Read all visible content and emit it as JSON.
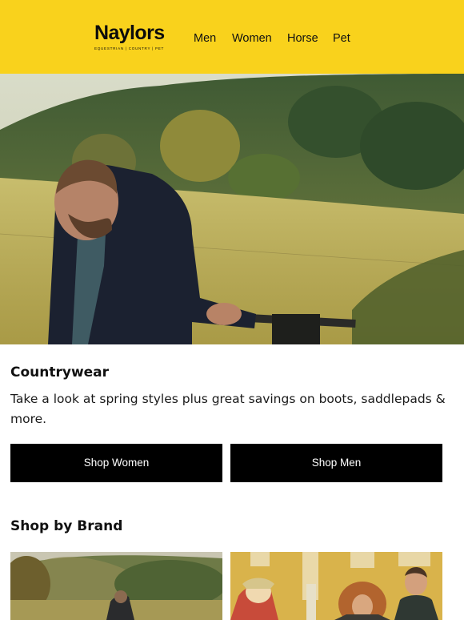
{
  "header": {
    "logo": "Naylors",
    "tagline": "EQUESTRIAN | COUNTRY | PET",
    "nav": [
      "Men",
      "Women",
      "Horse",
      "Pet"
    ],
    "background_color": "#f9d21c"
  },
  "hero": {
    "image": "man-in-quilted-jacket-at-field-gate"
  },
  "countrywear": {
    "title": "Countrywear",
    "body": "Take a look at spring styles plus great savings on boots, saddlepads & more.",
    "buttons": [
      "Shop Women",
      "Shop Men"
    ]
  },
  "brands": {
    "title": "Shop by Brand",
    "cards": [
      {
        "image": "man-walking-in-countryside"
      },
      {
        "image": "group-of-friends-outside-building"
      }
    ]
  }
}
